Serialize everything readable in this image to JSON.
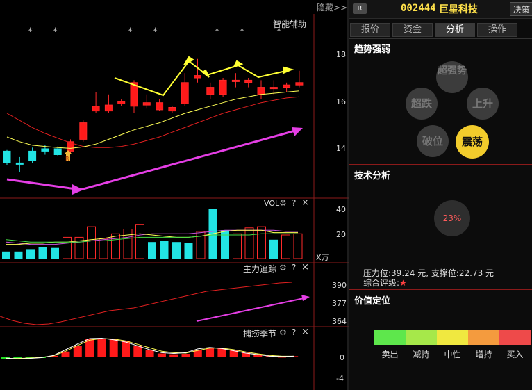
{
  "header": {
    "badge": "R",
    "code": "002444",
    "name": "巨星科技",
    "decision_btn": "决策"
  },
  "hide_label": "隐藏>>",
  "tabs": [
    "报价",
    "资金",
    "分析",
    "操作"
  ],
  "active_tab": "分析",
  "trend": {
    "title": "趋势强弱",
    "items": [
      "超强势",
      "超跌",
      "上升",
      "破位",
      "震荡"
    ],
    "active": "震荡"
  },
  "tech": {
    "title": "技术分析",
    "percent": "23%",
    "pressure": "压力位:39.24 元, 支撑位:22.73 元",
    "rating_label": "综合评级:",
    "rating_star": "★"
  },
  "value": {
    "title": "价值定位",
    "levels": [
      {
        "label": "卖出",
        "color": "#5ee74c"
      },
      {
        "label": "减持",
        "color": "#a6e84a"
      },
      {
        "label": "中性",
        "color": "#f0e840"
      },
      {
        "label": "增持",
        "color": "#f49b3e"
      },
      {
        "label": "买入",
        "color": "#ee4a4a"
      }
    ]
  },
  "main_chart": {
    "indicator_label": "智能辅助",
    "y_ticks": [
      "18",
      "16",
      "14"
    ],
    "stars": [
      "*",
      "*",
      "*",
      "*",
      "*",
      "*",
      "*"
    ],
    "marker": "R"
  },
  "vol_panel": {
    "title": "VOL",
    "y_ticks": [
      "40",
      "20"
    ],
    "unit": "X万",
    "help": "?",
    "close": "×"
  },
  "main_force": {
    "title": "主力追踪",
    "y_ticks": [
      "390",
      "377",
      "364"
    ],
    "help": "?",
    "close": "×"
  },
  "season": {
    "title": "捕捞季节",
    "y_ticks": [
      "0",
      "-4"
    ],
    "help": "?",
    "close": "×"
  },
  "chart_data": {
    "type": "candlestick",
    "y_range": [
      13.0,
      19.0
    ],
    "candles": [
      {
        "o": 13.4,
        "c": 13.9,
        "h": 13.95,
        "l": 13.3,
        "up": false
      },
      {
        "o": 13.35,
        "c": 13.4,
        "h": 13.65,
        "l": 13.0,
        "up": false
      },
      {
        "o": 13.5,
        "c": 13.9,
        "h": 14.05,
        "l": 13.4,
        "up": false
      },
      {
        "o": 13.9,
        "c": 14.0,
        "h": 14.15,
        "l": 13.75,
        "up": false
      },
      {
        "o": 13.75,
        "c": 14.0,
        "h": 14.1,
        "l": 13.7,
        "up": false
      },
      {
        "o": 13.9,
        "c": 14.3,
        "h": 14.4,
        "l": 13.8,
        "up": true
      },
      {
        "o": 14.4,
        "c": 15.1,
        "h": 15.2,
        "l": 14.3,
        "up": true
      },
      {
        "o": 15.6,
        "c": 15.8,
        "h": 16.4,
        "l": 15.5,
        "up": true
      },
      {
        "o": 15.6,
        "c": 15.85,
        "h": 16.3,
        "l": 15.5,
        "up": true
      },
      {
        "o": 15.9,
        "c": 16.0,
        "h": 16.1,
        "l": 15.8,
        "up": true
      },
      {
        "o": 15.8,
        "c": 16.8,
        "h": 16.9,
        "l": 15.5,
        "up": true
      },
      {
        "o": 15.95,
        "c": 15.85,
        "h": 16.3,
        "l": 15.7,
        "up": true
      },
      {
        "o": 15.95,
        "c": 15.65,
        "h": 16.1,
        "l": 15.6,
        "up": true
      },
      {
        "o": 15.75,
        "c": 15.6,
        "h": 15.8,
        "l": 15.5,
        "up": true
      },
      {
        "o": 15.9,
        "c": 16.8,
        "h": 17.2,
        "l": 15.8,
        "up": true
      },
      {
        "o": 17.0,
        "c": 17.1,
        "h": 17.8,
        "l": 16.8,
        "up": true
      },
      {
        "o": 16.3,
        "c": 16.6,
        "h": 16.8,
        "l": 16.1,
        "up": true
      },
      {
        "o": 16.3,
        "c": 16.9,
        "h": 17.0,
        "l": 16.2,
        "up": true
      },
      {
        "o": 16.9,
        "c": 16.9,
        "h": 17.2,
        "l": 16.6,
        "up": true
      },
      {
        "o": 16.8,
        "c": 16.9,
        "h": 17.0,
        "l": 16.6,
        "up": true
      },
      {
        "o": 16.3,
        "c": 16.6,
        "h": 16.9,
        "l": 16.1,
        "up": true
      },
      {
        "o": 16.6,
        "c": 16.6,
        "h": 16.9,
        "l": 16.3,
        "up": true
      },
      {
        "o": 16.6,
        "c": 16.7,
        "h": 16.8,
        "l": 16.4,
        "up": true
      },
      {
        "o": 16.7,
        "c": 16.8,
        "h": 17.3,
        "l": 16.6,
        "up": true
      }
    ],
    "ma_yellow": [
      14.5,
      14.3,
      14.15,
      14.1,
      14.05,
      14.02,
      14.08,
      14.2,
      14.4,
      14.6,
      14.8,
      14.95,
      15.1,
      15.3,
      15.5,
      15.65,
      15.8,
      15.95,
      16.1,
      16.2,
      16.3,
      16.35,
      16.4,
      16.45
    ],
    "ma_red": [
      15.2,
      14.9,
      14.65,
      14.45,
      14.25,
      14.1,
      14.05,
      14.05,
      14.1,
      14.2,
      14.35,
      14.5,
      14.7,
      14.9,
      15.1,
      15.3,
      15.5,
      15.65,
      15.8,
      15.95,
      16.05,
      16.15,
      16.2,
      16.25
    ],
    "volume": [
      6,
      6,
      8,
      10,
      9,
      18,
      18,
      27,
      17,
      21,
      25,
      29,
      14,
      15,
      14,
      13,
      23,
      42,
      24,
      21,
      26,
      27,
      16,
      20,
      21
    ],
    "volume_up": [
      false,
      false,
      false,
      false,
      false,
      true,
      true,
      true,
      true,
      true,
      true,
      true,
      false,
      false,
      false,
      false,
      true,
      false,
      false,
      true,
      true,
      true,
      false,
      true,
      true
    ],
    "vol_ma_yellow": [
      12,
      12,
      13,
      13,
      14,
      14,
      15,
      16,
      17,
      19,
      20,
      21,
      20,
      19,
      18,
      18,
      19,
      21,
      23,
      24,
      24,
      24,
      22,
      22,
      22
    ],
    "vol_ma_purple": [
      14,
      13,
      12,
      12,
      12,
      13,
      14,
      15,
      16,
      17,
      18,
      20,
      21,
      21,
      21,
      21,
      22,
      23,
      24,
      24,
      24,
      24,
      24,
      23,
      23
    ],
    "vol_ma_green": [
      16,
      15,
      14,
      14,
      14,
      14,
      14,
      15,
      15,
      16,
      17,
      18,
      18,
      18,
      18,
      18,
      19,
      20,
      20,
      20,
      20,
      21,
      21,
      21,
      21
    ],
    "main_force_line": [
      368,
      365,
      363,
      362,
      362.5,
      364,
      366,
      368,
      370,
      372,
      373,
      374,
      376,
      378,
      380,
      382,
      384,
      386,
      387,
      388,
      389,
      390,
      391,
      392,
      392.5
    ],
    "season_bars": [
      -0.4,
      -0.5,
      -0.3,
      -0.1,
      0.4,
      1.5,
      3.0,
      4.8,
      5.0,
      4.8,
      4.2,
      3.0,
      2.0,
      1.0,
      0.8,
      0.9,
      2.0,
      2.5,
      2.3,
      1.8,
      1.2,
      0.8,
      0.3,
      0.1,
      0.3
    ],
    "season_line_white": [
      -0.2,
      -0.4,
      -0.3,
      -0.1,
      0.5,
      2.0,
      3.5,
      4.9,
      5.0,
      4.6,
      4.0,
      3.0,
      2.0,
      1.2,
      1.0,
      1.2,
      2.2,
      2.6,
      2.3,
      1.7,
      1.1,
      0.7,
      0.3,
      0.2,
      0.3
    ],
    "season_line_yellow": [
      -0.3,
      -0.3,
      -0.2,
      0.0,
      0.4,
      1.6,
      3.1,
      4.5,
      4.9,
      4.8,
      4.3,
      3.4,
      2.5,
      1.6,
      1.2,
      1.1,
      1.8,
      2.4,
      2.4,
      2.0,
      1.4,
      0.9,
      0.5,
      0.3,
      0.3
    ]
  }
}
